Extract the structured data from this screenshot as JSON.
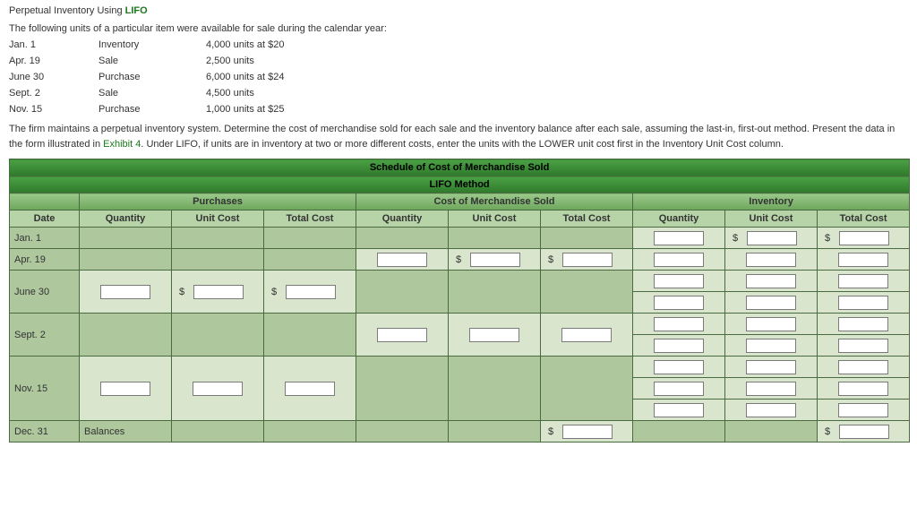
{
  "title_prefix": "Perpetual Inventory Using ",
  "title_suffix": "LIFO",
  "intro": "The following units of a particular item were available for sale during the calendar year:",
  "data_rows": [
    {
      "date": "Jan. 1",
      "type": "Inventory",
      "detail": "4,000 units at $20"
    },
    {
      "date": "Apr. 19",
      "type": "Sale",
      "detail": "2,500 units"
    },
    {
      "date": "June 30",
      "type": "Purchase",
      "detail": "6,000 units at $24"
    },
    {
      "date": "Sept. 2",
      "type": "Sale",
      "detail": "4,500 units"
    },
    {
      "date": "Nov. 15",
      "type": "Purchase",
      "detail": "1,000 units at $25"
    }
  ],
  "instructions_1": "The firm maintains a perpetual inventory system. Determine the cost of merchandise sold for each sale and the inventory balance after each sale, assuming the last-in, first-out method. Present the data in the form illustrated in ",
  "exhibit_link": "Exhibit 4",
  "instructions_2": ". Under LIFO, if units are in inventory at two or more different costs, enter the units with the LOWER unit cost first in the Inventory Unit Cost column.",
  "schedule": {
    "title_main": "Schedule of Cost of Merchandise Sold",
    "title_sub": "LIFO Method",
    "group_purchases": "Purchases",
    "group_cogs": "Cost of Merchandise Sold",
    "group_inventory": "Inventory",
    "col_date": "Date",
    "col_qty": "Quantity",
    "col_unitcost": "Unit Cost",
    "col_totalcost": "Total Cost",
    "rows": {
      "jan1": "Jan. 1",
      "apr19": "Apr. 19",
      "jun30": "June 30",
      "sep2": "Sept. 2",
      "nov15": "Nov. 15",
      "dec31": "Dec. 31",
      "balances": "Balances"
    },
    "dollar": "$"
  }
}
